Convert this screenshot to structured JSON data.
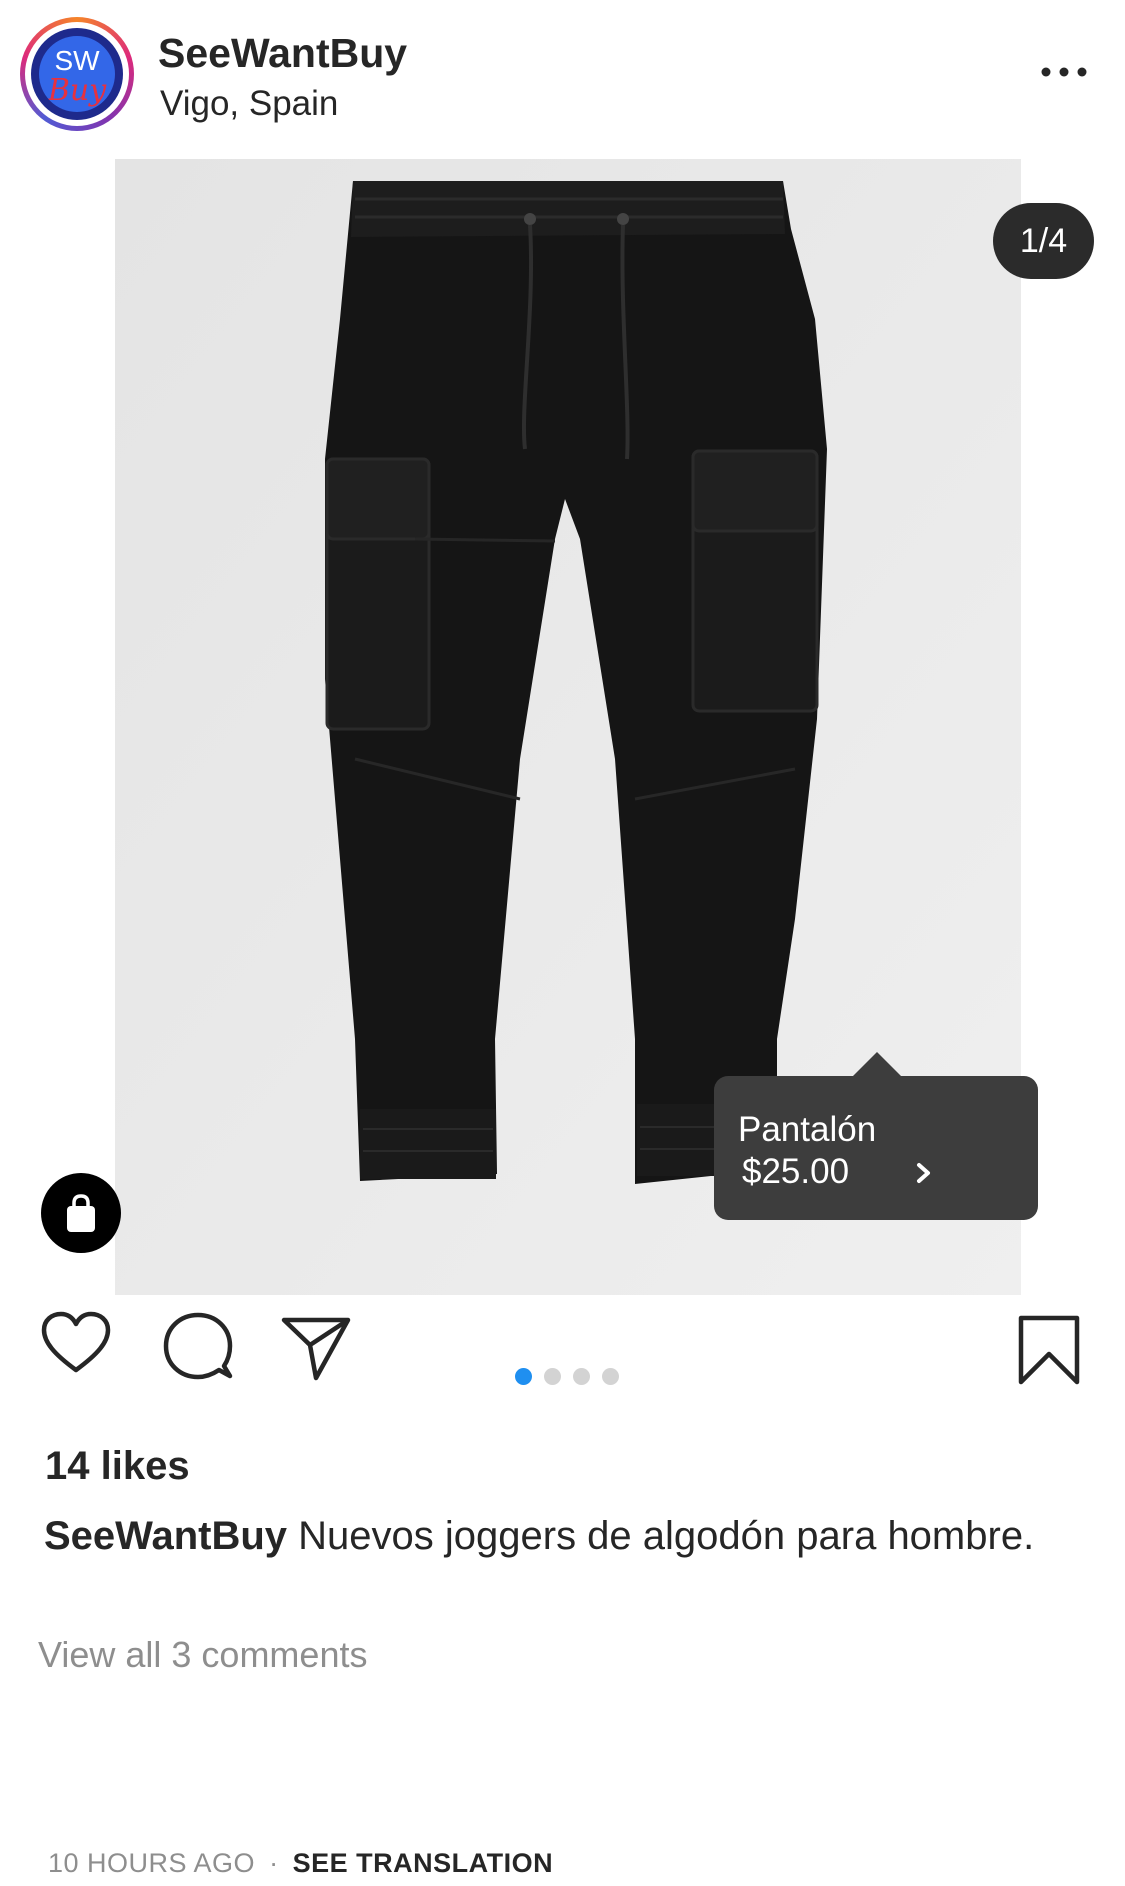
{
  "header": {
    "avatar_top_text": "SW",
    "avatar_bottom_text": "Buy",
    "username": "SeeWantBuy",
    "location": "Vigo, Spain"
  },
  "photo": {
    "counter": "1/4",
    "product_tag": {
      "name": "Pantalón",
      "price": "$25.00"
    }
  },
  "carousel": {
    "total": 4,
    "active_index": 0
  },
  "post": {
    "likes": "14 likes",
    "caption_user": "SeeWantBuy",
    "caption_text": "Nuevos joggers de algodón para hombre.",
    "view_comments": "View all 3 comments",
    "time": "10 HOURS AGO",
    "separator": "·",
    "see_translation": "SEE TRANSLATION"
  },
  "colors": {
    "accent": "#1f8ff0",
    "text": "#262626",
    "muted": "#8e8e8e",
    "tag_bg": "#3d3d3d"
  },
  "icons": [
    "more-icon",
    "shopping-bag-icon",
    "heart-icon",
    "comment-icon",
    "share-icon",
    "bookmark-icon",
    "chevron-right-icon"
  ]
}
